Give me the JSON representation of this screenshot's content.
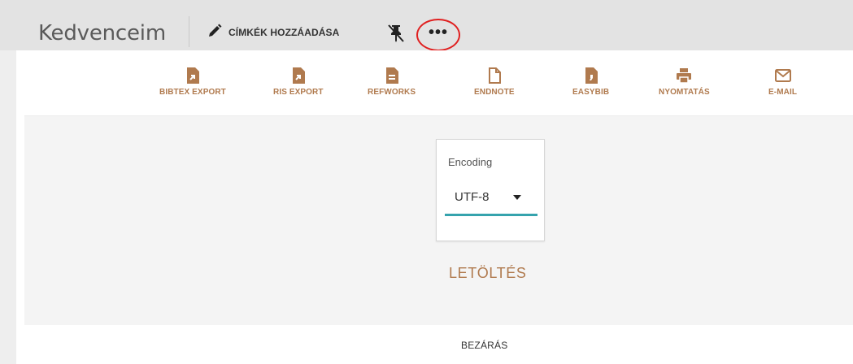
{
  "header": {
    "title": "Kedvenceim",
    "add_tags_label": "CÍMKÉK HOZZÁADÁSA",
    "more_label": "•••"
  },
  "exports": [
    {
      "label": "BIBTEX EXPORT",
      "icon": "file-export-icon"
    },
    {
      "label": "RIS EXPORT",
      "icon": "file-export-icon"
    },
    {
      "label": "REFWORKS",
      "icon": "document-icon"
    },
    {
      "label": "ENDNOTE",
      "icon": "file-outline-icon"
    },
    {
      "label": "EASYBIB",
      "icon": "file-easybib-icon"
    },
    {
      "label": "NYOMTATÁS",
      "icon": "printer-icon"
    },
    {
      "label": "E-MAIL",
      "icon": "mail-icon"
    }
  ],
  "encoding": {
    "label": "Encoding",
    "value": "UTF-8"
  },
  "download_label": "LETÖLTÉS",
  "close_label": "BEZÁRÁS",
  "colors": {
    "accent": "#b07a4e",
    "underline": "#35a3ad",
    "highlight": "#e02020"
  }
}
